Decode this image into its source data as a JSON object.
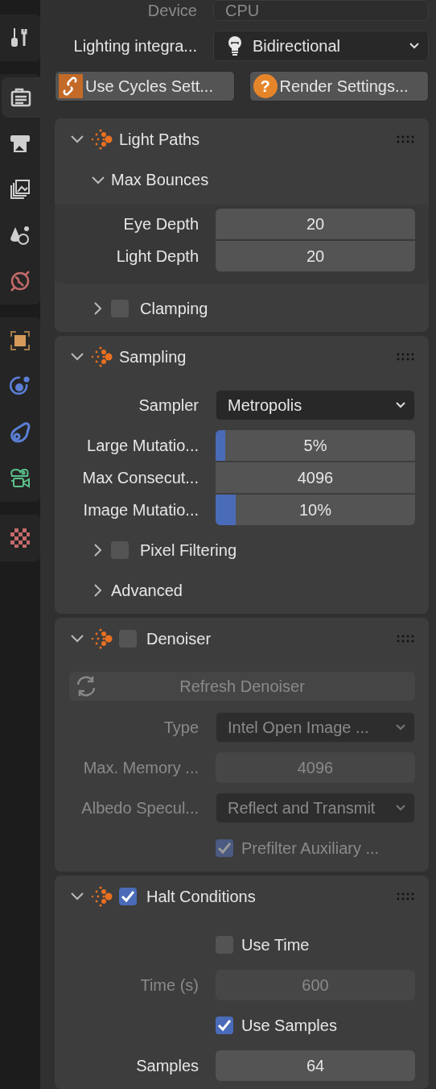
{
  "sidebar": {
    "groups": [
      {
        "tabs": [
          {
            "kind": "tool",
            "selected": false
          }
        ]
      },
      {
        "tabs": [
          {
            "kind": "render",
            "selected": true
          },
          {
            "kind": "output",
            "selected": false
          },
          {
            "kind": "view_layer",
            "selected": false
          },
          {
            "kind": "scene",
            "selected": false
          },
          {
            "kind": "world",
            "selected": false
          }
        ]
      },
      {
        "tabs": [
          {
            "kind": "object",
            "selected": false
          },
          {
            "kind": "physics",
            "selected": false
          },
          {
            "kind": "constraints",
            "selected": false
          },
          {
            "kind": "camera_data",
            "selected": false
          }
        ]
      },
      {
        "tabs": [
          {
            "kind": "texture",
            "selected": false
          }
        ]
      }
    ]
  },
  "device": {
    "label": "Device",
    "value": "CPU",
    "disabled": true
  },
  "lighting_integrator": {
    "label": "Lighting integra...",
    "value": "Bidirectional"
  },
  "buttons": [
    {
      "kind": "link",
      "label": "Use Cycles Sett..."
    },
    {
      "kind": "help",
      "icon_glyph": "?",
      "label": "Render Settings..."
    }
  ],
  "panels": [
    {
      "title": "Light Paths",
      "expanded": true,
      "rows": [
        {
          "kind": "subpanel",
          "label": "Max Bounces",
          "expanded": true,
          "rows": [
            {
              "kind": "number",
              "label": "Eye Depth",
              "value": "20",
              "disabled": false
            },
            {
              "kind": "number",
              "label": "Light Depth",
              "value": "20",
              "disabled": false
            }
          ]
        },
        {
          "kind": "subpanel",
          "label": "Clamping",
          "expanded": false,
          "checkbox": {
            "checked": false
          }
        }
      ]
    },
    {
      "title": "Sampling",
      "expanded": true,
      "rows": [
        {
          "kind": "dropdown",
          "label": "Sampler",
          "value": "Metropolis",
          "disabled": false
        },
        {
          "kind": "slider",
          "label": "Large Mutatio...",
          "value": "5%",
          "level": 0.05,
          "disabled": false
        },
        {
          "kind": "number",
          "label": "Max Consecut...",
          "value": "4096",
          "disabled": false
        },
        {
          "kind": "slider",
          "label": "Image Mutatio...",
          "value": "10%",
          "level": 0.1,
          "disabled": false
        },
        {
          "kind": "subpanel",
          "label": "Pixel Filtering",
          "expanded": false,
          "checkbox": {
            "checked": false
          }
        },
        {
          "kind": "subpanel",
          "label": "Advanced",
          "expanded": false
        }
      ]
    },
    {
      "title": "Denoiser",
      "expanded": true,
      "checkbox": {
        "checked": false
      },
      "rows": [
        {
          "kind": "button",
          "label": "Refresh Denoiser",
          "disabled": true
        },
        {
          "kind": "dropdown",
          "label": "Type",
          "value": "Intel Open Image ...",
          "disabled": true
        },
        {
          "kind": "number",
          "label": "Max. Memory ...",
          "value": "4096",
          "disabled": true
        },
        {
          "kind": "dropdown",
          "label": "Albedo Specul...",
          "value": "Reflect and Transmit",
          "disabled": true
        },
        {
          "kind": "checkbox",
          "label": "Prefilter Auxiliary ...",
          "checked": true,
          "disabled": true
        }
      ]
    },
    {
      "title": "Halt Conditions",
      "expanded": true,
      "checkbox": {
        "checked": true
      },
      "rows": [
        {
          "kind": "checkbox",
          "label": "Use Time",
          "checked": false,
          "disabled": false
        },
        {
          "kind": "number",
          "label": "Time (s)",
          "value": "600",
          "disabled": true
        },
        {
          "kind": "checkbox",
          "label": "Use Samples",
          "checked": true,
          "disabled": false
        },
        {
          "kind": "number",
          "label": "Samples",
          "value": "64",
          "disabled": false
        }
      ]
    }
  ]
}
